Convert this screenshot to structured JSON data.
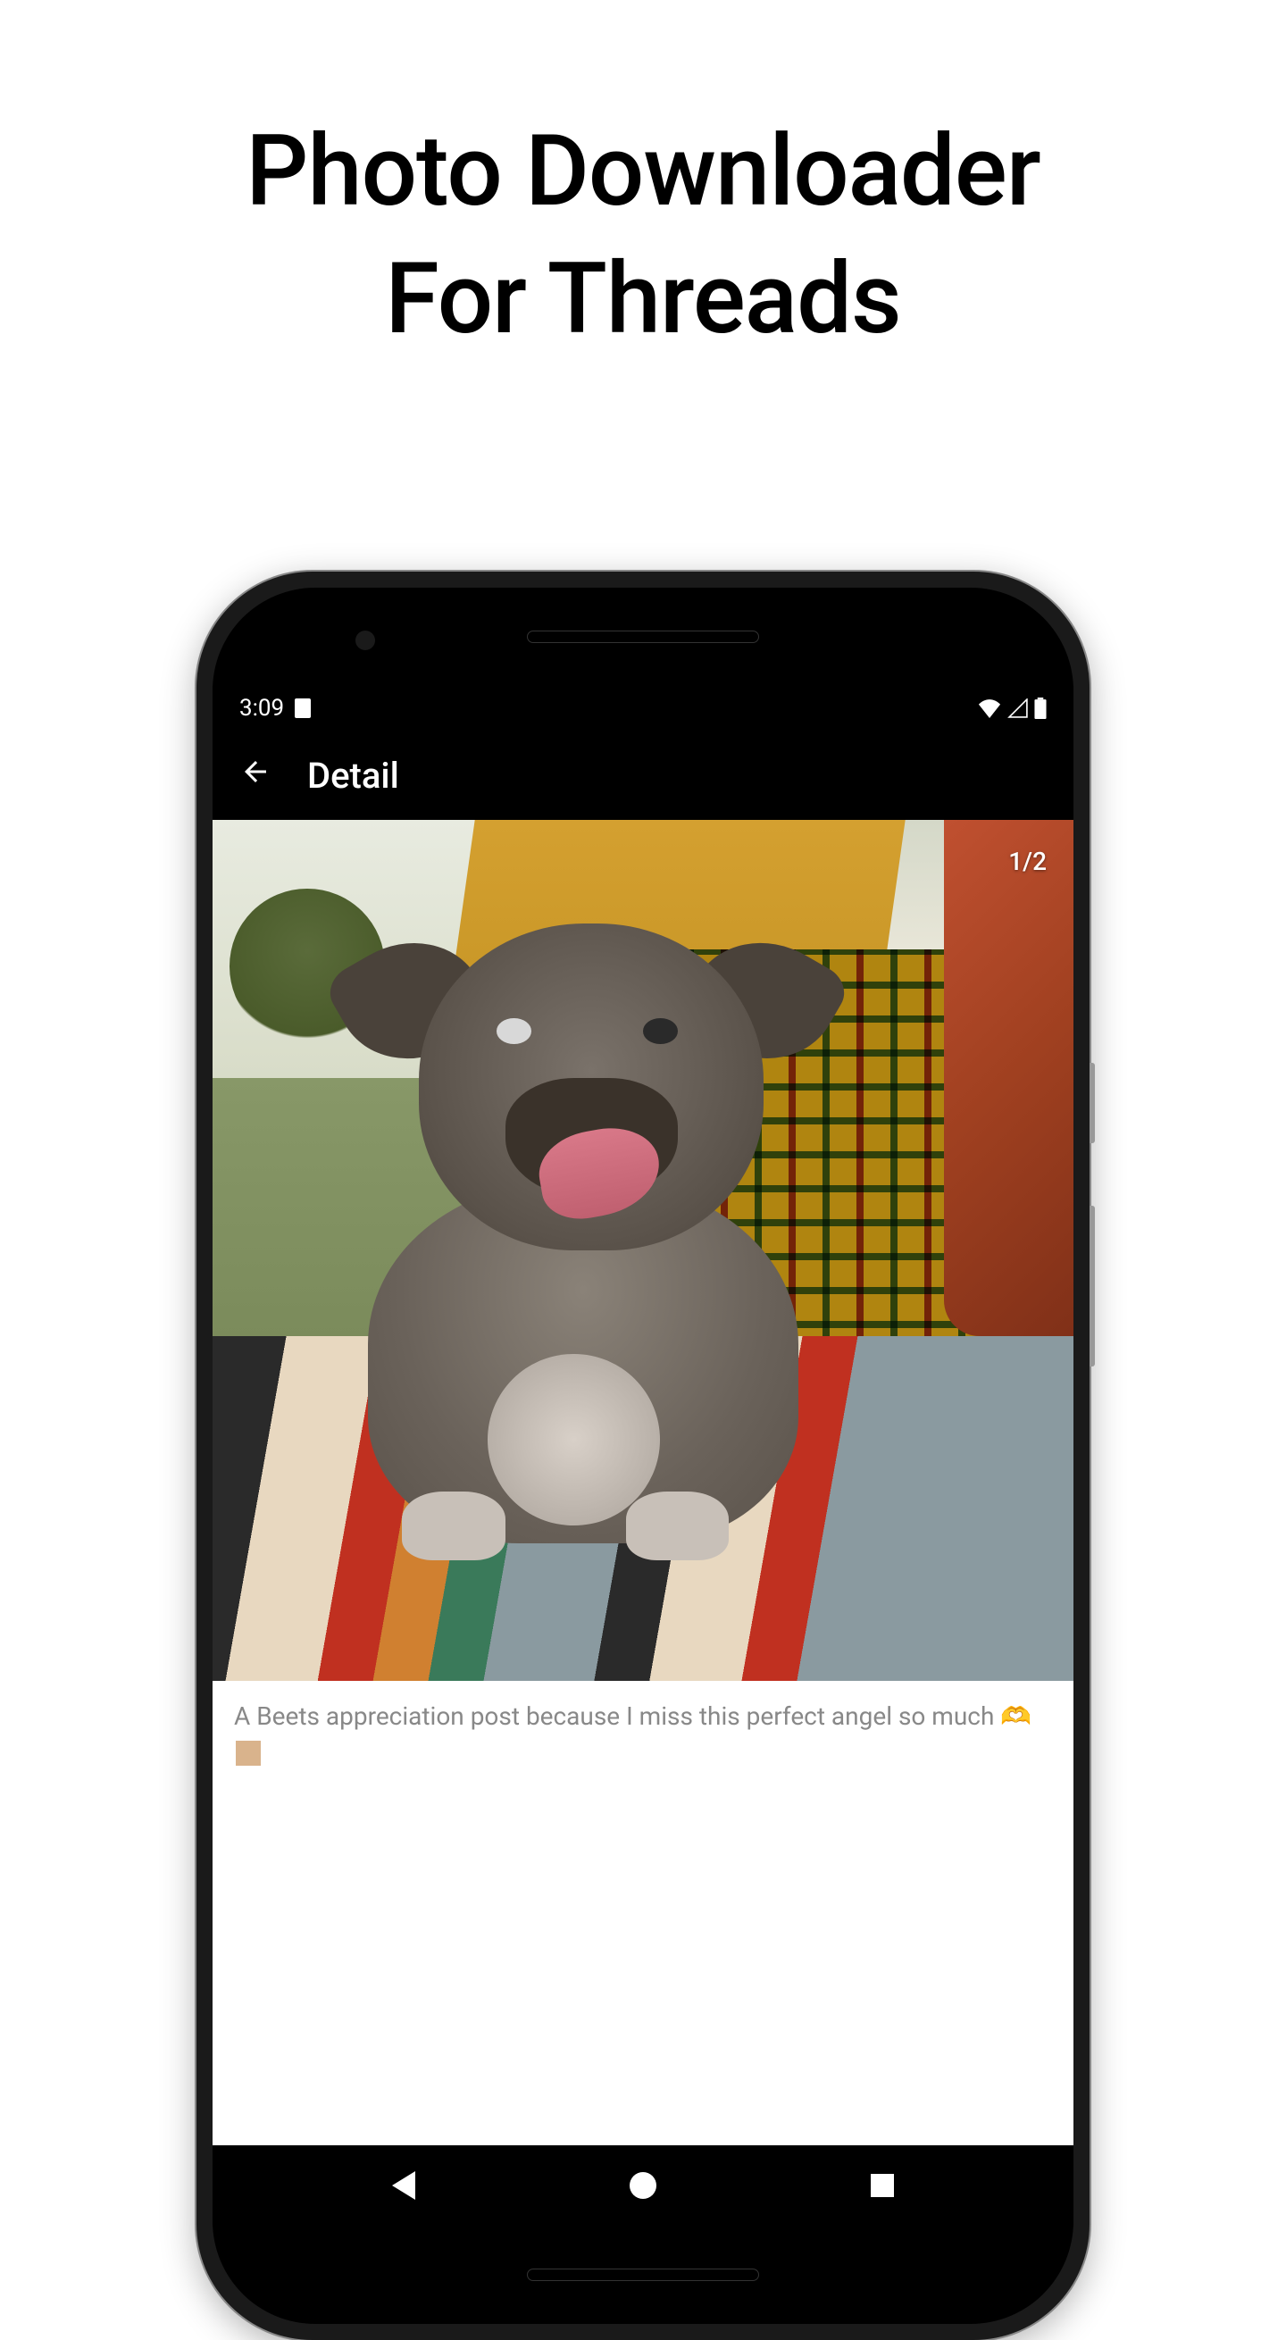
{
  "promo": {
    "title_line1": "Photo Downloader",
    "title_line2": "For Threads"
  },
  "statusBar": {
    "time": "3:09"
  },
  "header": {
    "title": "Detail"
  },
  "detail": {
    "imageCounter": "1/2",
    "caption": "A Beets appreciation post because I miss this perfect angel so much 🫶"
  }
}
